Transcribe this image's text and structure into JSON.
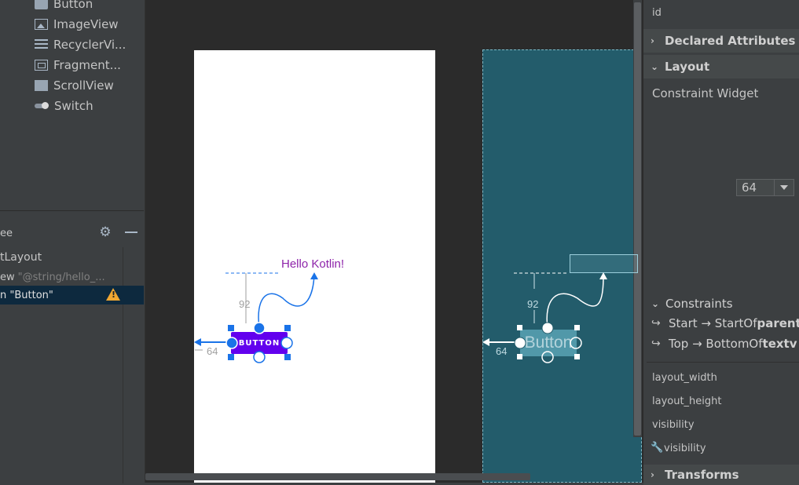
{
  "palette": {
    "items": [
      {
        "label": "Button",
        "icon": "button-icon"
      },
      {
        "label": "ImageView",
        "icon": "imageview-icon"
      },
      {
        "label": "RecyclerVi...",
        "icon": "recyclerview-icon"
      },
      {
        "label": "Fragment...",
        "icon": "fragment-icon"
      },
      {
        "label": "ScrollView",
        "icon": "scrollview-icon"
      },
      {
        "label": "Switch",
        "icon": "switch-icon"
      }
    ]
  },
  "component_tree": {
    "title": "ee",
    "rows": [
      {
        "label": "tLayout",
        "sub": ""
      },
      {
        "label": "ew",
        "sub": "\"@string/hello_..."
      },
      {
        "label": "n \"Button\"",
        "sub": "",
        "warning": true
      }
    ]
  },
  "canvas": {
    "design": {
      "hello_text": "Hello Kotlin!",
      "button_text": "BUTTON",
      "margin_top": "92",
      "margin_start": "64",
      "accent_color": "#6200ee",
      "selection_color": "#1a73e8"
    },
    "blueprint": {
      "button_text": "Button",
      "margin_top": "92",
      "margin_start": "64"
    }
  },
  "attributes": {
    "id_label": "id",
    "sections": {
      "declared": "Declared Attributes",
      "layout": "Layout",
      "transforms": "Transforms"
    },
    "constraint_widget_label": "Constraint Widget",
    "margin_value": "64",
    "constraints": {
      "label": "Constraints",
      "start_prefix": "Start → StartOf ",
      "start_target": "parent",
      "top_prefix": "Top → BottomOf ",
      "top_target": "textv"
    },
    "fields": {
      "layout_width": "layout_width",
      "layout_height": "layout_height",
      "visibility": "visibility",
      "tools_visibility": "visibility"
    }
  }
}
